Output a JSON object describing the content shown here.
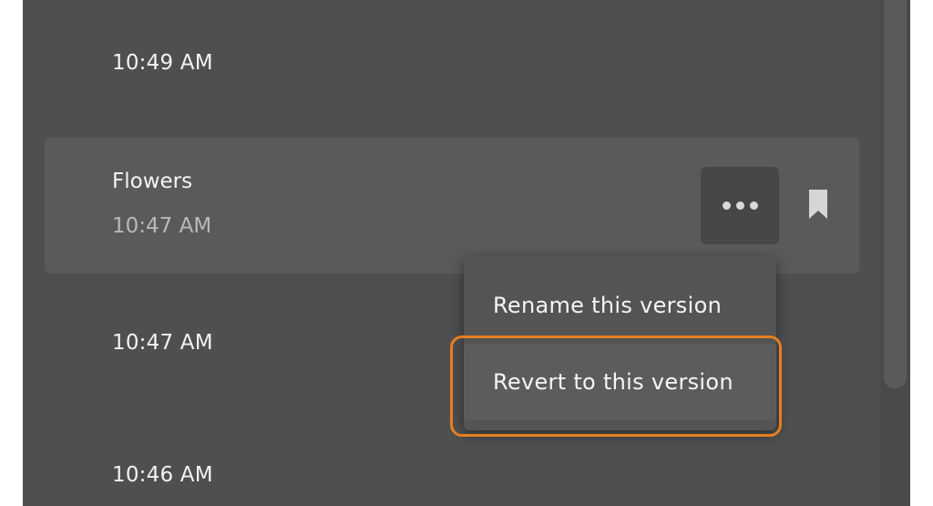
{
  "versions": [
    {
      "time": "10:49 AM"
    },
    {
      "name": "Flowers",
      "time": "10:47 AM",
      "selected": true
    },
    {
      "time": "10:47 AM"
    },
    {
      "time": "10:46 AM"
    }
  ],
  "selected_card": {
    "more_icon": "ellipsis-icon",
    "bookmark_icon": "bookmark-icon"
  },
  "context_menu": {
    "items": [
      {
        "label": "Rename this version"
      },
      {
        "label": "Revert to this version",
        "highlighted": true
      }
    ]
  },
  "colors": {
    "panel_bg": "#4f4f4f",
    "selected_card_bg": "#5a5a5a",
    "menu_bg": "#545454",
    "highlight_border": "#e67e22",
    "text_primary": "#f2f2f2",
    "text_secondary": "#b9b9b9"
  }
}
